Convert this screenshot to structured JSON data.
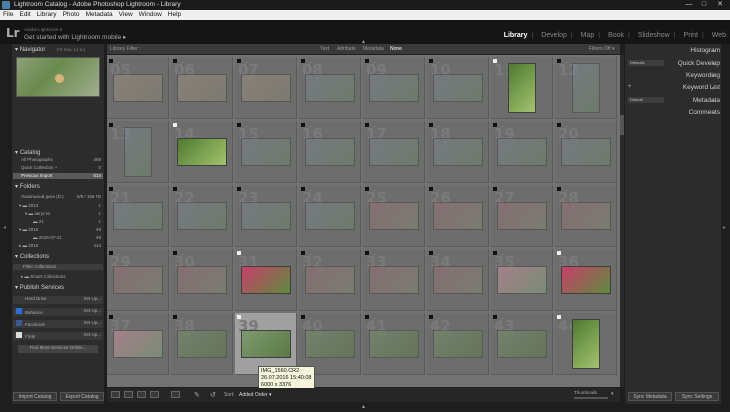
{
  "window": {
    "title": "Lightroom Catalog - Adobe Photoshop Lightroom - Library",
    "min": "—",
    "max": "□",
    "close": "✕"
  },
  "menu": [
    "File",
    "Edit",
    "Library",
    "Photo",
    "Metadata",
    "View",
    "Window",
    "Help"
  ],
  "header": {
    "logo": "Lr",
    "version_text": "Adobe Lightroom 6",
    "mobile_text": "Get started with Lightroom mobile ▸"
  },
  "modules": [
    "Library",
    "Develop",
    "Map",
    "Book",
    "Slideshow",
    "Print",
    "Web"
  ],
  "active_module": "Library",
  "left": {
    "navigator": {
      "title": "Navigator",
      "zoom": [
        "FIT",
        "FILL",
        "1:1",
        "3:1"
      ]
    },
    "catalog": {
      "title": "Catalog",
      "items": [
        {
          "label": "All Photographs",
          "count": "469"
        },
        {
          "label": "Quick Collection +",
          "count": "0"
        },
        {
          "label": "Previous Import",
          "count": "614"
        }
      ]
    },
    "folders": {
      "title": "Folders",
      "items": [
        {
          "label": "Локальный диск (D:)",
          "count": "5/8 / 166 ГБ"
        },
        {
          "label": "2013",
          "count": "1"
        },
        {
          "label": "августа",
          "count": "1"
        },
        {
          "label": "21",
          "count": "1"
        },
        {
          "label": "2016",
          "count": "49"
        },
        {
          "label": "2016-07-11",
          "count": "49"
        },
        {
          "label": "2016",
          "count": "414"
        }
      ]
    },
    "collections": {
      "title": "Collections",
      "items": [
        "Filter Collections",
        "Smart Collections"
      ]
    },
    "publish": {
      "title": "Publish Services",
      "items": [
        {
          "label": "Hard Drive",
          "action": "Set Up..."
        },
        {
          "label": "Behance",
          "action": "Set Up..."
        },
        {
          "label": "Facebook",
          "action": "Set Up..."
        },
        {
          "label": "Flickr",
          "action": "Set Up..."
        }
      ],
      "find_more": "Find More Services Online..."
    },
    "import_btn": "Import Catalog",
    "export_btn": "Export Catalog"
  },
  "filterbar": {
    "title": "Library Filter :",
    "tabs": [
      "Text",
      "Attribute",
      "Metadata",
      "None"
    ],
    "active": "None",
    "filters_off": "Filters Off ▾"
  },
  "right": {
    "panels": [
      "Histogram",
      "Quick Develop",
      "Keywording",
      "Keyword List",
      "Metadata",
      "Comments"
    ],
    "qd_preset": "Defaults",
    "md_preset": "Default",
    "sync_metadata": "Sync Metadata",
    "sync_settings": "Sync Settings"
  },
  "grid": {
    "rows": [
      [
        {
          "n": "05",
          "s": "a",
          "o": "h"
        },
        {
          "n": "06",
          "s": "a",
          "o": "h"
        },
        {
          "n": "07",
          "s": "a",
          "o": "h"
        },
        {
          "n": "08",
          "s": "c",
          "o": "h"
        },
        {
          "n": "09",
          "s": "c",
          "o": "h"
        },
        {
          "n": "10",
          "s": "c",
          "o": "h"
        },
        {
          "n": "11",
          "s": "g",
          "o": "v",
          "f": 1
        },
        {
          "n": "12",
          "s": "c",
          "o": "v"
        }
      ],
      [
        {
          "n": "13",
          "s": "c",
          "o": "v"
        },
        {
          "n": "14",
          "s": "g",
          "o": "h",
          "f": 1
        },
        {
          "n": "15",
          "s": "c",
          "o": "h"
        },
        {
          "n": "16",
          "s": "c",
          "o": "h"
        },
        {
          "n": "17",
          "s": "c",
          "o": "h"
        },
        {
          "n": "18",
          "s": "c",
          "o": "h"
        },
        {
          "n": "19",
          "s": "c",
          "o": "h"
        },
        {
          "n": "20",
          "s": "c",
          "o": "h"
        }
      ],
      [
        {
          "n": "21",
          "s": "c",
          "o": "h"
        },
        {
          "n": "22",
          "s": "c",
          "o": "h"
        },
        {
          "n": "23",
          "s": "c",
          "o": "h"
        },
        {
          "n": "24",
          "s": "c",
          "o": "h"
        },
        {
          "n": "25",
          "s": "d",
          "o": "h"
        },
        {
          "n": "26",
          "s": "d",
          "o": "h"
        },
        {
          "n": "27",
          "s": "d",
          "o": "h"
        },
        {
          "n": "28",
          "s": "d",
          "o": "h"
        }
      ],
      [
        {
          "n": "29",
          "s": "d",
          "o": "h"
        },
        {
          "n": "30",
          "s": "d",
          "o": "h"
        },
        {
          "n": "31",
          "s": "f",
          "o": "h",
          "f": 1
        },
        {
          "n": "32",
          "s": "d",
          "o": "h"
        },
        {
          "n": "33",
          "s": "d",
          "o": "h"
        },
        {
          "n": "34",
          "s": "d",
          "o": "h"
        },
        {
          "n": "35",
          "s": "e",
          "o": "h"
        },
        {
          "n": "36",
          "s": "f",
          "o": "h",
          "f": 1
        }
      ],
      [
        {
          "n": "37",
          "s": "e",
          "o": "h"
        },
        {
          "n": "38",
          "s": "b",
          "o": "h"
        },
        {
          "n": "39",
          "s": "b",
          "o": "h",
          "f": 1,
          "sel": 1
        },
        {
          "n": "40",
          "s": "b",
          "o": "h"
        },
        {
          "n": "41",
          "s": "b",
          "o": "h"
        },
        {
          "n": "42",
          "s": "b",
          "o": "h"
        },
        {
          "n": "43",
          "s": "b",
          "o": "h"
        },
        {
          "n": "44",
          "s": "g",
          "o": "v",
          "f": 1
        }
      ]
    ]
  },
  "tooltip": {
    "line1": "IMG_1560.CR2",
    "line2": "26.07.2016 15:40:08",
    "line3": "6000 x 3376"
  },
  "toolbar": {
    "sort_label": "Sort:",
    "sort_value": "Added Order ▾",
    "thumbnails": "Thumbnails"
  }
}
